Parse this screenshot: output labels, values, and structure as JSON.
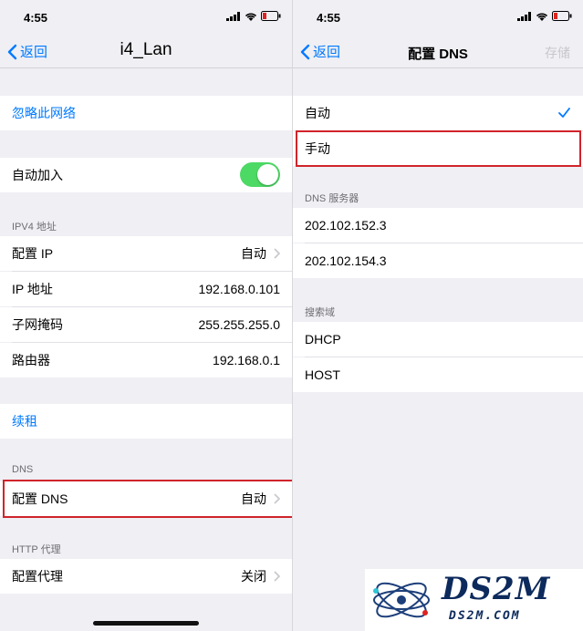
{
  "left": {
    "status_time": "4:55",
    "back_label": "返回",
    "title": "i4_Lan",
    "forget_label": "忽略此网络",
    "auto_join_label": "自动加入",
    "auto_join_on": true,
    "ipv4_header": "IPV4 地址",
    "rows": [
      {
        "label": "配置 IP",
        "value": "自动"
      },
      {
        "label": "IP 地址",
        "value": "192.168.0.101"
      },
      {
        "label": "子网掩码",
        "value": "255.255.255.0"
      },
      {
        "label": "路由器",
        "value": "192.168.0.1"
      }
    ],
    "renew_label": "续租",
    "dns_header": "DNS",
    "dns_row": {
      "label": "配置 DNS",
      "value": "自动"
    },
    "http_header": "HTTP 代理",
    "proxy_row": {
      "label": "配置代理",
      "value": "关闭"
    }
  },
  "right": {
    "status_time": "4:55",
    "back_label": "返回",
    "title": "配置 DNS",
    "save_label": "存储",
    "mode_auto": "自动",
    "mode_manual": "手动",
    "dns_servers_header": "DNS 服务器",
    "dns_servers": [
      "202.102.152.3",
      "202.102.154.3"
    ],
    "search_domains_header": "搜索域",
    "search_domains": [
      "DHCP",
      "HOST"
    ]
  },
  "watermark": {
    "big": "DS2M",
    "small": "DS2M.COM"
  },
  "colors": {
    "accent": "#007aff",
    "toggle_on": "#4cd964",
    "highlight": "#d0232a",
    "background": "#efeff4"
  }
}
